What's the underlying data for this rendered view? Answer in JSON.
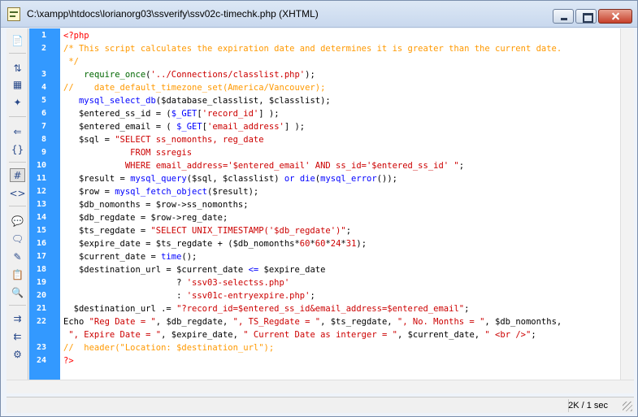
{
  "window": {
    "title": "C:\\xampp\\htdocs\\lorianorg03\\ssverify\\ssv02c-timechk.php (XHTML)",
    "controls": [
      "minimize",
      "maximize",
      "close"
    ]
  },
  "toolbar": {
    "icons": [
      "file-management-icon",
      "expand-all-icon",
      "select-parent-tag-icon",
      "balance-braces-icon",
      "collapse-full-tag-icon",
      "collapse-selection-icon",
      "expand-icon",
      "line-numbers-icon",
      "highlight-invalid-code-icon",
      "apply-comment-icon",
      "remove-comment-icon",
      "wrap-tag-icon",
      "recent-snippets-icon",
      "move-css-icon",
      "indent-code-icon",
      "outdent-code-icon",
      "format-source-icon"
    ]
  },
  "editor": {
    "line_number_color": "#ffffff",
    "gutter_color": "#3399ff",
    "lines": [
      {
        "n": "1",
        "segments": [
          {
            "t": "<?php",
            "c": "#ff0000"
          }
        ]
      },
      {
        "n": "2",
        "segments": [
          {
            "t": "/* This script calculates the expiration date and determines it is greater than the current date.",
            "c": "#ff9900"
          }
        ]
      },
      {
        "n": "",
        "segments": [
          {
            "t": " */",
            "c": "#ff9900"
          }
        ]
      },
      {
        "n": "3",
        "segments": [
          {
            "t": "    ",
            "c": "#000000"
          },
          {
            "t": "require_once",
            "c": "#006600"
          },
          {
            "t": "(",
            "c": "#000000"
          },
          {
            "t": "'../Connections/classlist.php'",
            "c": "#cc0000"
          },
          {
            "t": ");",
            "c": "#000000"
          }
        ]
      },
      {
        "n": "4",
        "segments": [
          {
            "t": "//    date_default_timezone_set(America/Vancouver);",
            "c": "#ff9900"
          }
        ]
      },
      {
        "n": "5",
        "segments": [
          {
            "t": "   ",
            "c": "#000000"
          },
          {
            "t": "mysql_select_db",
            "c": "#0000ff"
          },
          {
            "t": "($database_classlist, $classlist);",
            "c": "#000000"
          }
        ]
      },
      {
        "n": "6",
        "segments": [
          {
            "t": "   $entered_ss_id = (",
            "c": "#000000"
          },
          {
            "t": "$_GET",
            "c": "#0000ff"
          },
          {
            "t": "[",
            "c": "#000000"
          },
          {
            "t": "'record_id'",
            "c": "#cc0000"
          },
          {
            "t": "] );",
            "c": "#000000"
          }
        ]
      },
      {
        "n": "7",
        "segments": [
          {
            "t": "   $entered_email = ( ",
            "c": "#000000"
          },
          {
            "t": "$_GET",
            "c": "#0000ff"
          },
          {
            "t": "[",
            "c": "#000000"
          },
          {
            "t": "'email_address'",
            "c": "#cc0000"
          },
          {
            "t": "] );",
            "c": "#000000"
          }
        ]
      },
      {
        "n": "8",
        "segments": [
          {
            "t": "   $sql = ",
            "c": "#000000"
          },
          {
            "t": "\"SELECT ss_nomonths, reg_date",
            "c": "#cc0000"
          }
        ]
      },
      {
        "n": "9",
        "segments": [
          {
            "t": "             FROM ssregis",
            "c": "#cc0000"
          }
        ]
      },
      {
        "n": "10",
        "segments": [
          {
            "t": "            WHERE email_address='$entered_email' AND ss_id='$entered_ss_id' \"",
            "c": "#cc0000"
          },
          {
            "t": ";",
            "c": "#000000"
          }
        ]
      },
      {
        "n": "11",
        "segments": [
          {
            "t": "   $result = ",
            "c": "#000000"
          },
          {
            "t": "mysql_query",
            "c": "#0000ff"
          },
          {
            "t": "($sql, $classlist) ",
            "c": "#000000"
          },
          {
            "t": "or",
            "c": "#0000ff"
          },
          {
            "t": " ",
            "c": "#000000"
          },
          {
            "t": "die",
            "c": "#0000ff"
          },
          {
            "t": "(",
            "c": "#000000"
          },
          {
            "t": "mysql_error",
            "c": "#0000ff"
          },
          {
            "t": "());",
            "c": "#000000"
          }
        ]
      },
      {
        "n": "12",
        "segments": [
          {
            "t": "   $row = ",
            "c": "#000000"
          },
          {
            "t": "mysql_fetch_object",
            "c": "#0000ff"
          },
          {
            "t": "($result);",
            "c": "#000000"
          }
        ]
      },
      {
        "n": "13",
        "segments": [
          {
            "t": "   $db_nomonths = $row->ss_nomonths;",
            "c": "#000000"
          }
        ]
      },
      {
        "n": "14",
        "segments": [
          {
            "t": "   $db_regdate = $row->reg_date;",
            "c": "#000000"
          }
        ]
      },
      {
        "n": "15",
        "segments": [
          {
            "t": "   $ts_regdate = ",
            "c": "#000000"
          },
          {
            "t": "\"SELECT UNIX_TIMESTAMP('$db_regdate')\"",
            "c": "#cc0000"
          },
          {
            "t": ";",
            "c": "#000000"
          }
        ]
      },
      {
        "n": "16",
        "segments": [
          {
            "t": "   $expire_date = $ts_regdate + ($db_nomonths*",
            "c": "#000000"
          },
          {
            "t": "60",
            "c": "#cc0000"
          },
          {
            "t": "*",
            "c": "#000000"
          },
          {
            "t": "60",
            "c": "#cc0000"
          },
          {
            "t": "*",
            "c": "#000000"
          },
          {
            "t": "24",
            "c": "#cc0000"
          },
          {
            "t": "*",
            "c": "#000000"
          },
          {
            "t": "31",
            "c": "#cc0000"
          },
          {
            "t": ");",
            "c": "#000000"
          }
        ]
      },
      {
        "n": "17",
        "segments": [
          {
            "t": "   $current_date = ",
            "c": "#000000"
          },
          {
            "t": "time",
            "c": "#0000ff"
          },
          {
            "t": "();",
            "c": "#000000"
          }
        ]
      },
      {
        "n": "18",
        "segments": [
          {
            "t": "   $destination_url = $current_date ",
            "c": "#000000"
          },
          {
            "t": "<=",
            "c": "#0000ff"
          },
          {
            "t": " $expire_date",
            "c": "#000000"
          }
        ]
      },
      {
        "n": "19",
        "segments": [
          {
            "t": "                      ? ",
            "c": "#000000"
          },
          {
            "t": "'ssv03-selectss.php'",
            "c": "#cc0000"
          }
        ]
      },
      {
        "n": "20",
        "segments": [
          {
            "t": "                      : ",
            "c": "#000000"
          },
          {
            "t": "'ssv01c-entryexpire.php'",
            "c": "#cc0000"
          },
          {
            "t": ";",
            "c": "#000000"
          }
        ]
      },
      {
        "n": "21",
        "segments": [
          {
            "t": "  $destination_url .= ",
            "c": "#000000"
          },
          {
            "t": "\"?record_id=$entered_ss_id&email_address=$entered_email\"",
            "c": "#cc0000"
          },
          {
            "t": ";",
            "c": "#000000"
          }
        ]
      },
      {
        "n": "22",
        "segments": [
          {
            "t": "Echo ",
            "c": "#000000"
          },
          {
            "t": "\"Reg Date = \"",
            "c": "#cc0000"
          },
          {
            "t": ", $db_regdate, ",
            "c": "#000000"
          },
          {
            "t": "\", TS_Regdate = \"",
            "c": "#cc0000"
          },
          {
            "t": ", $ts_regdate, ",
            "c": "#000000"
          },
          {
            "t": "\", No. Months = \"",
            "c": "#cc0000"
          },
          {
            "t": ", $db_nomonths,",
            "c": "#000000"
          }
        ]
      },
      {
        "n": "",
        "segments": [
          {
            "t": " ",
            "c": "#000000"
          },
          {
            "t": "\", Expire Date = \"",
            "c": "#cc0000"
          },
          {
            "t": ", $expire_date, ",
            "c": "#000000"
          },
          {
            "t": "\" Current Date as interger = \"",
            "c": "#cc0000"
          },
          {
            "t": ", $current_date, ",
            "c": "#000000"
          },
          {
            "t": "\" <br />\"",
            "c": "#cc0000"
          },
          {
            "t": ";",
            "c": "#000000"
          }
        ]
      },
      {
        "n": "23",
        "segments": [
          {
            "t": "//  header(\"Location: $destination_url\");",
            "c": "#ff9900"
          }
        ]
      },
      {
        "n": "24",
        "segments": [
          {
            "t": "?>",
            "c": "#ff0000"
          }
        ]
      }
    ]
  },
  "statusbar": {
    "size_time": "2K / 1 sec"
  }
}
